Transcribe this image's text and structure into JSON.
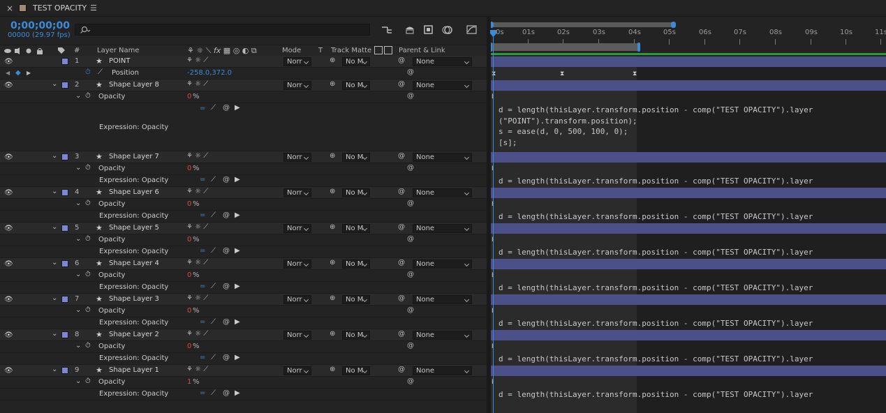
{
  "tab": {
    "close": "×",
    "title": "TEST OPACITY",
    "menu": "☰"
  },
  "timecode": {
    "value": "0;00;00;00",
    "frames": "00000 (29.97 fps)"
  },
  "search": {
    "placeholder": ""
  },
  "columns": {
    "layer_name": "Layer Name",
    "mode": "Mode",
    "t": "T",
    "track_matte": "Track Matte",
    "parent_link": "Parent & Link",
    "number": "#"
  },
  "ruler": {
    "labels": [
      "0s",
      "01s",
      "02s",
      "03s",
      "04s",
      "05s",
      "06s",
      "07s",
      "08s",
      "09s",
      "10s",
      "11s"
    ]
  },
  "layers": [
    {
      "num": "1",
      "name": "POINT",
      "mode": "Norr",
      "matte": "No M",
      "parent": "None"
    },
    {
      "num": "2",
      "name": "Shape Layer 8",
      "mode": "Norr",
      "matte": "No M",
      "parent": "None"
    },
    {
      "num": "3",
      "name": "Shape Layer 7",
      "mode": "Norr",
      "matte": "No M",
      "parent": "None"
    },
    {
      "num": "4",
      "name": "Shape Layer 6",
      "mode": "Norr",
      "matte": "No M",
      "parent": "None"
    },
    {
      "num": "5",
      "name": "Shape Layer 5",
      "mode": "Norr",
      "matte": "No M",
      "parent": "None"
    },
    {
      "num": "6",
      "name": "Shape Layer 4",
      "mode": "Norr",
      "matte": "No M",
      "parent": "None"
    },
    {
      "num": "7",
      "name": "Shape Layer 3",
      "mode": "Norr",
      "matte": "No M",
      "parent": "None"
    },
    {
      "num": "8",
      "name": "Shape Layer 2",
      "mode": "Norr",
      "matte": "No M",
      "parent": "None"
    },
    {
      "num": "9",
      "name": "Shape Layer 1",
      "mode": "Norr",
      "matte": "No M",
      "parent": "None"
    }
  ],
  "position": {
    "label": "Position",
    "value": "-258.0,372.0"
  },
  "opacity": {
    "label": "Opacity",
    "values": [
      "0",
      "0",
      "0",
      "0",
      "0",
      "0",
      "0",
      "1"
    ],
    "unit": "%"
  },
  "expression_label": "Expression: Opacity",
  "expression_full": "d = length(thisLayer.transform.position - comp(\"TEST OPACITY\").layer\n(\"POINT\").transform.position);\ns = ease(d, 0, 500, 100, 0);\n[s];",
  "expression_short": "d = length(thisLayer.transform.position - comp(\"TEST OPACITY\").layer",
  "colors": {
    "label": "#7a86d6",
    "bar": "#4b5188",
    "accent": "#3c8bd9",
    "work_area": "#2a9d3a"
  }
}
